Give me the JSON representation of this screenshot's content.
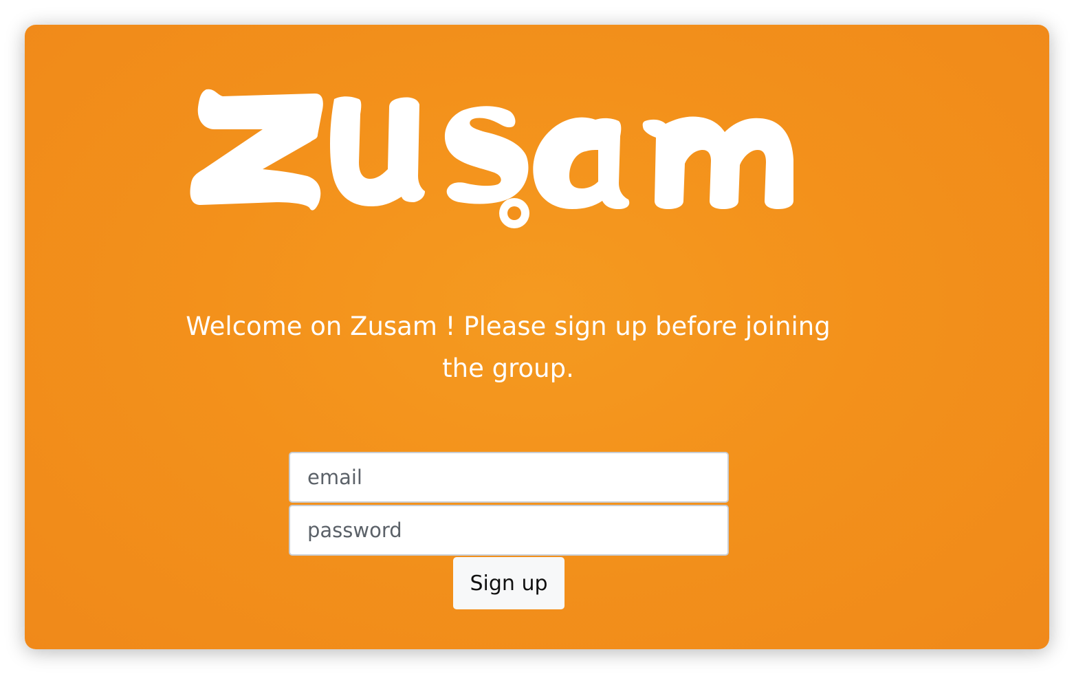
{
  "app": {
    "logo_text": "zusam",
    "welcome_message": "Welcome on Zusam ! Please sign up before joining the group."
  },
  "signup": {
    "email_placeholder": "email",
    "password_placeholder": "password",
    "submit_label": "Sign up"
  },
  "colors": {
    "background": "#f3911b",
    "logo": "#ffffff",
    "text": "#ffffff",
    "button_bg": "#f7f8f9"
  }
}
